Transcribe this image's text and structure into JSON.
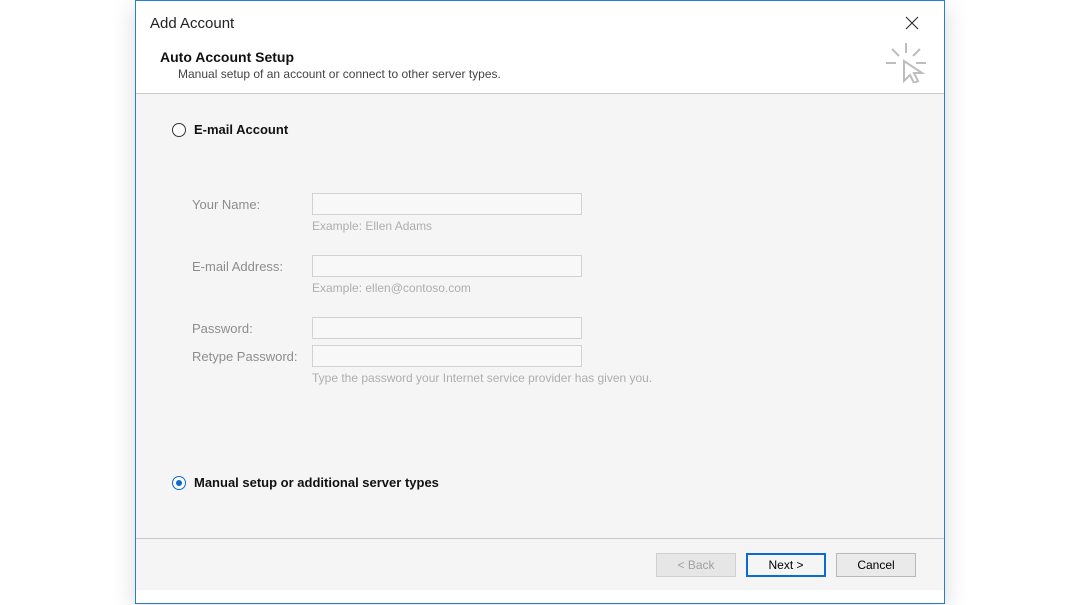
{
  "window": {
    "title": "Add Account"
  },
  "header": {
    "title": "Auto Account Setup",
    "subtitle": "Manual setup of an account or connect to other server types."
  },
  "options": {
    "email_account": {
      "label": "E-mail Account",
      "selected": false
    },
    "manual": {
      "label": "Manual setup or additional server types",
      "selected": true
    }
  },
  "form": {
    "name_label": "Your Name:",
    "name_hint": "Example: Ellen Adams",
    "email_label": "E-mail Address:",
    "email_hint": "Example: ellen@contoso.com",
    "password_label": "Password:",
    "retype_label": "Retype Password:",
    "password_hint": "Type the password your Internet service provider has given you."
  },
  "footer": {
    "back": "< Back",
    "next": "Next >",
    "cancel": "Cancel"
  }
}
